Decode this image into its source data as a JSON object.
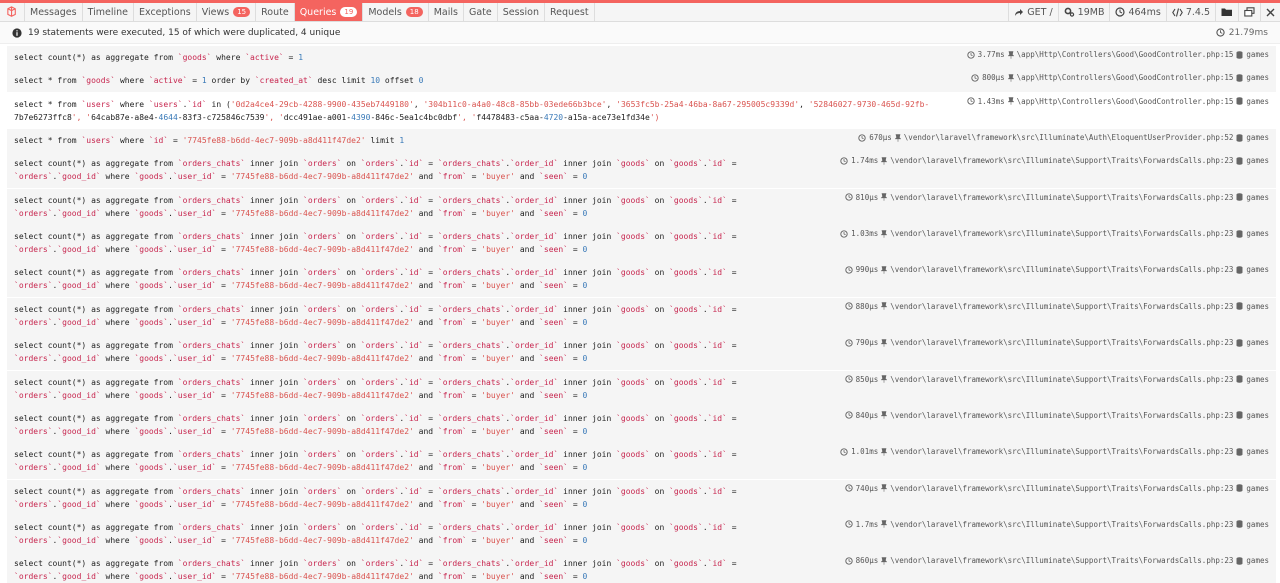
{
  "tabs": [
    {
      "label": "Messages"
    },
    {
      "label": "Timeline"
    },
    {
      "label": "Exceptions"
    },
    {
      "label": "Views",
      "badge": "15"
    },
    {
      "label": "Route"
    },
    {
      "label": "Queries",
      "badge": "19",
      "active": true
    },
    {
      "label": "Models",
      "badge": "18"
    },
    {
      "label": "Mails"
    },
    {
      "label": "Gate"
    },
    {
      "label": "Session"
    },
    {
      "label": "Request"
    }
  ],
  "toolbar": {
    "method": "GET /",
    "memory": "19MB",
    "time": "464ms",
    "php": "7.4.5"
  },
  "summary": {
    "text": "19 statements were executed, 15 of which were duplicated, 4 unique",
    "total_time": "21.79ms"
  },
  "queries": [
    {
      "lines": [
        "select count(*) as aggregate from `goods` where `active` = 1"
      ],
      "time": "3.77ms",
      "source": "\\app\\Http\\Controllers\\Good\\GoodController.php:15",
      "db": "games",
      "height": 23
    },
    {
      "lines": [
        "select * from `goods` where `active` = 1 order by `created_at` desc limit 10 offset 0"
      ],
      "time": "800μs",
      "source": "\\app\\Http\\Controllers\\Good\\GoodController.php:15",
      "db": "games",
      "height": 23
    },
    {
      "lines": [
        "select * from `users` where `users`.`id` in ('0d2a4ce4-29cb-4288-9900-435eb7449180', '304b11c0-a4a0-48c8-85bb-03ede66b3bce', '3653fc5b-25a4-46ba-8a67-295005c9339d', '52846027-9730-465d-92fb-",
        "7b7e6273ffc8', '64cab87e-a8e4-4644-83f3-c725846c7539', 'dcc491ae-a001-4390-846c-5ea1c4bc0dbf', 'f4478483-c5aa-4720-a15a-ace73e1fd34e')"
      ],
      "time": "1.43ms",
      "source": "\\app\\Http\\Controllers\\Good\\GoodController.php:15",
      "db": "games",
      "height": 36
    },
    {
      "lines": [
        "select * from `users` where `id` = '7745fe88-b6dd-4ec7-909b-a8d411f47de2' limit 1"
      ],
      "time": "670μs",
      "source": "\\vendor\\laravel\\framework\\src\\Illuminate\\Auth\\EloquentUserProvider.php:52",
      "db": "games",
      "height": 23
    },
    {
      "repeat": true,
      "time": "1.74ms"
    },
    {
      "repeat": true,
      "time": "810μs"
    },
    {
      "repeat": true,
      "time": "1.03ms"
    },
    {
      "repeat": true,
      "time": "990μs"
    },
    {
      "repeat": true,
      "time": "880μs"
    },
    {
      "repeat": true,
      "time": "790μs"
    },
    {
      "repeat": true,
      "time": "850μs"
    },
    {
      "repeat": true,
      "time": "840μs"
    },
    {
      "repeat": true,
      "time": "1.01ms"
    },
    {
      "repeat": true,
      "time": "740μs"
    },
    {
      "repeat": true,
      "time": "1.7ms"
    },
    {
      "repeat": true,
      "time": "860μs"
    }
  ],
  "repeat_query": {
    "lines": [
      "select count(*) as aggregate from `orders_chats` inner join `orders` on `orders`.`id` = `orders_chats`.`order_id` inner join `goods` on `goods`.`id` =",
      "`orders`.`good_id` where `goods`.`user_id` = '7745fe88-b6dd-4ec7-909b-a8d411f47de2' and `from` = 'buyer' and `seen` = 0"
    ],
    "source": "\\vendor\\laravel\\framework\\src\\Illuminate\\Support\\Traits\\ForwardsCalls.php:23",
    "db": "games"
  },
  "colors": {
    "accent": "#f4645f",
    "identifier": "#c7254e",
    "string": "#d9534f",
    "number": "#3a7ab8"
  }
}
